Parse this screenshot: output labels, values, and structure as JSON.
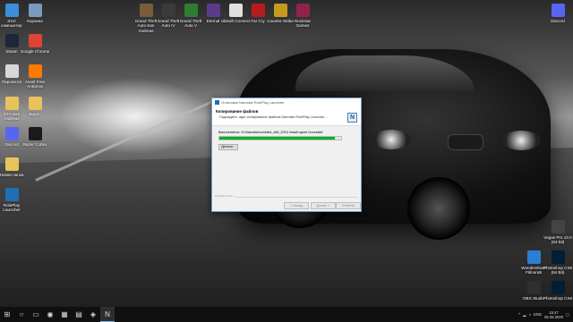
{
  "desktop": {
    "left_icons": [
      {
        "label": "Этот компьютер",
        "icon": "computer-icon",
        "color": "#3a8fd6"
      },
      {
        "label": "Корзина",
        "icon": "recycle-bin-icon",
        "color": "#7a9bbf"
      },
      {
        "label": "Steam",
        "icon": "steam-icon",
        "color": "#1b2838"
      },
      {
        "label": "Google Chrome",
        "icon": "chrome-icon",
        "color": "#db4437"
      },
      {
        "label": "Пароли.txt",
        "icon": "text-file-icon",
        "color": "#d8d8d8"
      },
      {
        "label": "Avast Free Antivirus",
        "icon": "avast-icon",
        "color": "#ff7800"
      },
      {
        "label": "GTA San Andreas",
        "icon": "folder-icon",
        "color": "#e8c25a"
      },
      {
        "label": "Видео",
        "icon": "folder-icon",
        "color": "#e8c25a"
      },
      {
        "label": "Discord",
        "icon": "discord-icon",
        "color": "#5865f2"
      },
      {
        "label": "Razer Cortex",
        "icon": "razer-icon",
        "color": "#1a1a1a"
      },
      {
        "label": "Новая папка",
        "icon": "folder-icon",
        "color": "#e8c25a"
      },
      {
        "label": "RolePlay Launcher",
        "icon": "launcher-icon",
        "color": "#1f6fb5"
      }
    ],
    "top_icons": [
      {
        "label": "Grand Theft Auto San Andreas",
        "icon": "gta-sa-icon",
        "color": "#7a5b3a"
      },
      {
        "label": "Grand Theft Auto IV",
        "icon": "gta-iv-icon",
        "color": "#3a3a3a"
      },
      {
        "label": "Grand Theft Auto V",
        "icon": "gta-v-icon",
        "color": "#2e7d32"
      },
      {
        "label": "Eternal",
        "icon": "game-icon",
        "color": "#5a3d8a"
      },
      {
        "label": "Ubisoft Connect",
        "icon": "ubisoft-icon",
        "color": "#e0e0e0"
      },
      {
        "label": "Far Cry",
        "icon": "game-icon",
        "color": "#b71c1c"
      },
      {
        "label": "Counter-Strike",
        "icon": "game-icon",
        "color": "#c79a1e"
      },
      {
        "label": "Rockstar Games",
        "icon": "game-icon",
        "color": "#8e244d"
      }
    ],
    "right_icons": [
      {
        "label": "Discord",
        "icon": "discord-icon",
        "color": "#5865f2"
      },
      {
        "label": "Vegas Pro 13.0 (64-bit)",
        "icon": "vegas-icon",
        "color": "#444"
      },
      {
        "label": "Wondershare Filmora9",
        "icon": "filmora-icon",
        "color": "#2a7fd4"
      },
      {
        "label": "Photoshop CS6 (64 Bit)",
        "icon": "photoshop-icon",
        "color": "#001e36"
      },
      {
        "label": "OBS Studio",
        "icon": "obs-icon",
        "color": "#302e31"
      },
      {
        "label": "Photoshop CS6",
        "icon": "photoshop-icon",
        "color": "#001e36"
      }
    ]
  },
  "dialog": {
    "window_title": "Установка Namalsk RolePlay Launcher",
    "header_title": "Копирование файлов",
    "header_subtitle": "Подождите, идет копирование файлов Namalsk RolePlay Launcher ...",
    "logo_glyph": "N",
    "status_text": "Выполняется: D:\\Namalsk\\vcredist_x86_2010 install.\\quiet /norestart",
    "progress_percent": 95,
    "details_button": "Детали...",
    "footer_text": "Namalsk v2.10",
    "back_button": "< Назад",
    "next_button": "Далее >",
    "cancel_button": "Отмена",
    "accent_color": "#06b025"
  },
  "taskbar": {
    "items": [
      {
        "glyph": "⊞",
        "icon": "start-icon"
      },
      {
        "glyph": "○",
        "icon": "search-icon"
      },
      {
        "glyph": "▭",
        "icon": "task-view-icon"
      },
      {
        "glyph": "◉",
        "icon": "chrome-icon"
      },
      {
        "glyph": "▦",
        "icon": "file-explorer-icon"
      },
      {
        "glyph": "▤",
        "icon": "store-icon"
      },
      {
        "glyph": "◈",
        "icon": "discord-icon"
      },
      {
        "glyph": "N",
        "icon": "launcher-icon"
      }
    ],
    "language": "ENG",
    "time": "15:47",
    "date": "06.05.2020"
  }
}
